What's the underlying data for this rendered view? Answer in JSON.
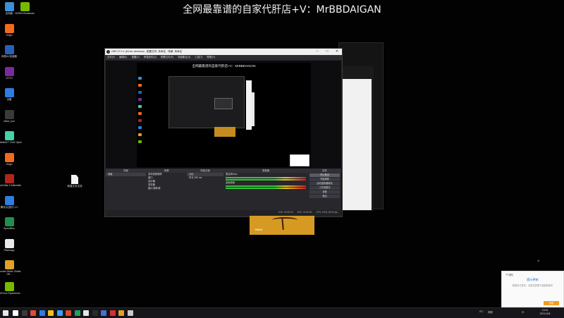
{
  "overlay": {
    "text": "全网最靠谱的自家代肝店+V：MrBBDAIGAN"
  },
  "desktop": {
    "icons_col1": [
      {
        "label": "此电脑",
        "color": "#3c8fd9"
      },
      {
        "label": "Origin",
        "color": "#f26a1c"
      },
      {
        "label": "网易UU加速器",
        "color": "#2a5fb8"
      },
      {
        "label": "UTVO",
        "color": "#7a2a9c"
      },
      {
        "label": "迅雷",
        "color": "#2c7ee0"
      },
      {
        "label": "office_tool",
        "color": "#3a3a3a"
      },
      {
        "label": "Battlefield™ 2042 Open",
        "color": "#43d1a5"
      },
      {
        "label": "Origin",
        "color": "#f26a1c"
      },
      {
        "label": "World War Z Aftermath",
        "color": "#b0261e"
      },
      {
        "label": "腾讯QQ音乐 1.0",
        "color": "#2f7de1"
      },
      {
        "label": "SpeedBox",
        "color": "#1e8f4e"
      },
      {
        "label": "Plasmapp",
        "color": "#e9e9e9"
      },
      {
        "label": "Counter-Strike Global Off...",
        "color": "#e0a02a"
      },
      {
        "label": "GeForce Experience",
        "color": "#76b900"
      }
    ],
    "icons_col2": [
      {
        "label": "NVIDIA Broadcast",
        "color": "#76b900"
      }
    ],
    "file": {
      "label": "新建文本文档"
    }
  },
  "obs": {
    "title": "OBS 27.0.1 (64-bit, windows) - 配置文件: 未命名 - 场景: 未命名",
    "menu": [
      "文件(F)",
      "编辑(E)",
      "视图(V)",
      "停靠部件(D)",
      "配置文件(P)",
      "场景集合(S)",
      "工具(T)",
      "帮助(H)"
    ],
    "preview_text": "全网最靠谱的自家代肝店+V：MrBBDAIGAN",
    "docks": {
      "scenes": {
        "title": "场景",
        "items": [
          "场景"
        ]
      },
      "sources": {
        "title": "来源",
        "items": [
          "游戏音频捕获",
          "窗口",
          "显示器",
          "浏览器",
          "图片/媒体源"
        ]
      },
      "transitions": {
        "title": "场景过渡",
        "items": [
          "淡出",
          "时长 300 ms"
        ]
      },
      "mixer": {
        "title": "混音器",
        "channels": [
          "麦克风/Aux",
          "桌面音频"
        ]
      },
      "controls": {
        "title": "控件",
        "buttons": [
          "停止推流",
          "开始录制",
          "启动虚拟摄像机",
          "工作室模式",
          "设置",
          "退出"
        ]
      }
    },
    "status": [
      "LIVE: 00:00:00",
      "REC: 00:00:00",
      "CPU: 0.5%, 60.00 fps"
    ]
  },
  "thumbnail": {
    "label": "Bilibili"
  },
  "notification": {
    "app": "TP通知",
    "title": "提示更新",
    "body": "新版本已发布，请前往官网下载最新版本",
    "button": "查看"
  },
  "taskbar": {
    "icons": [
      "#ffffff",
      "#3a3a3a",
      "#e04a3a",
      "#2f7de1",
      "#f0c020",
      "#3aa0ff",
      "#d94a2a",
      "#1ea260",
      "#e6e6e6",
      "#2b2b2b",
      "#4a6fd1",
      "#d63030",
      "#e0a02a",
      "#c8c8c8"
    ],
    "tray": [
      "8°C",
      "晴朗",
      "中"
    ],
    "time": "19:04",
    "date": "2021/11/8"
  }
}
